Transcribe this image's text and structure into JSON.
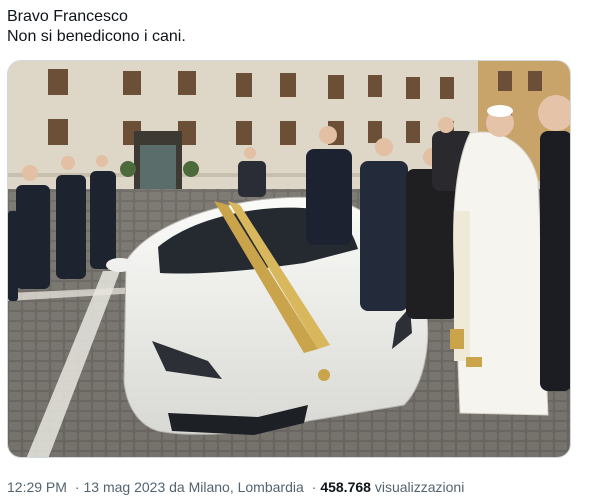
{
  "tweet": {
    "text": "Bravo Francesco\nNon si benedicono i cani.",
    "media": {
      "alt": "Photo of a white and gold sports car in a cobblestone courtyard with a group of people standing around it"
    },
    "meta": {
      "time": "12:29 PM",
      "date": "13 mag 2023",
      "location": "da Milano, Lombardia",
      "views_count": "458.768",
      "views_label": "visualizzazioni",
      "separator": "·"
    }
  }
}
